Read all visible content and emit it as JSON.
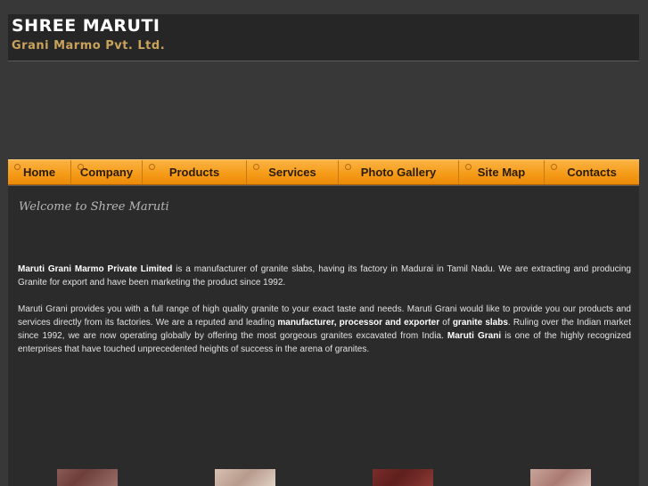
{
  "header": {
    "title": "Shree Maruti",
    "subtitle": "Grani Marmo Pvt. Ltd."
  },
  "nav": {
    "items": [
      {
        "label": "Home"
      },
      {
        "label": "Company"
      },
      {
        "label": "Products"
      },
      {
        "label": "Services"
      },
      {
        "label": "Photo Gallery"
      },
      {
        "label": "Site Map"
      },
      {
        "label": "Contacts"
      }
    ]
  },
  "main": {
    "welcome": "Welcome to Shree Maruti",
    "para1": {
      "company_bold": "Maruti Grani Marmo Private Limited",
      "text": " is a manufacturer of granite slabs, having its factory in Madurai in Tamil Nadu. We are extracting and producing Granite for export and have been marketing the product since 1992."
    },
    "para2": {
      "text_a": "Maruti Grani provides you with a full range of high quality granite to your exact taste and needs. Maruti Grani would like to provide you our products and services directly from its factories. We are a reputed and leading ",
      "bold_a": "manufacturer, processor and exporter",
      "text_b": " of ",
      "bold_b": "granite slabs",
      "text_c": ". Ruling over the Indian market since 1992, we are now operating globally by offering the most gorgeous granites excavated from India. ",
      "bold_c": "Maruti Grani",
      "text_d": " is one of the highly recognized enterprises that have touched unprecedented heights of success in the arena of granites."
    }
  },
  "colors": {
    "nav_orange": "#f59a16",
    "logo_gold": "#c9a35c",
    "background": "#383838"
  }
}
